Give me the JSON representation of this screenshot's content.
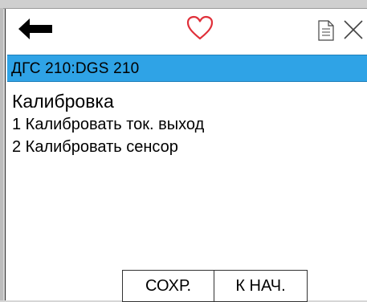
{
  "header": {
    "back_icon": "arrow-left-icon",
    "favorite_icon": "heart-outline-icon",
    "document_icon": "document-icon",
    "close_icon": "close-x-icon"
  },
  "title_bar": {
    "text": "ДГС 210:DGS 210",
    "color": "#2fa3e6"
  },
  "menu": {
    "heading": "Калибровка",
    "items": [
      {
        "label": "1 Калибровать ток. выход"
      },
      {
        "label": "2 Калибровать сенсор"
      }
    ]
  },
  "softkeys": {
    "save_label": "СОХР.",
    "home_label": "К НАЧ."
  },
  "colors": {
    "heart": "#e0303a",
    "accent": "#2fa3e6"
  }
}
